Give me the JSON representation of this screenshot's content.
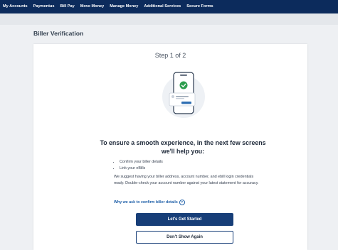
{
  "nav": {
    "items": [
      "My Accounts",
      "Paymentus",
      "Bill Pay",
      "Move Money",
      "Manage Money",
      "Additional Services",
      "Secure Forms"
    ]
  },
  "page": {
    "title": "Biller Verification"
  },
  "card": {
    "step": "Step 1 of 2",
    "heading": "To ensure a smooth experience, in the next few screens we'll help you:",
    "bullets": [
      "Confirm your biller details",
      "Link your eBills"
    ],
    "paragraph": "We suggest having your biller address, account number, and ebill login credentials ready. Double-check your account number against your latest statement for accuracy.",
    "why_link": "Why we ask to confirm biller details",
    "primary_button": "Let's Get Started",
    "secondary_button": "Don't Show Again"
  },
  "colors": {
    "nav_bg": "#0c2b5c",
    "primary": "#173e78",
    "link": "#1e5fa8",
    "success": "#2e9e4f"
  },
  "icons": {
    "illustration": "phone-checkmark-illustration",
    "help": "question-circle-icon"
  }
}
